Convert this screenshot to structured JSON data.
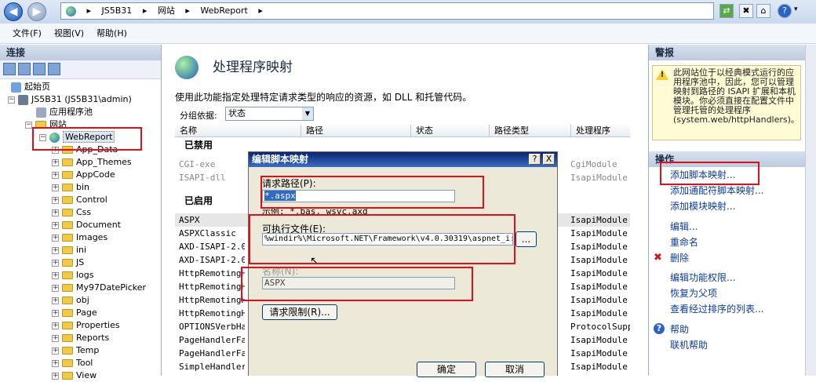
{
  "toolbar": {
    "back_icon": "back-arrow-icon",
    "forward_icon": "forward-arrow-icon",
    "address": [
      "JS5B31",
      "网站",
      "WebReport"
    ],
    "help_label": "?"
  },
  "menu": [
    "文件(F)",
    "视图(V)",
    "帮助(H)"
  ],
  "left": {
    "title": "连接",
    "tree": [
      {
        "label": "起始页",
        "icon": "start-page-icon",
        "level": 1
      },
      {
        "label": "JS5B31 (JS5B31\\admin)",
        "icon": "server-icon",
        "level": 1
      },
      {
        "label": "应用程序池",
        "icon": "app-pool-icon",
        "level": 2
      },
      {
        "label": "网站",
        "icon": "sites-folder-icon",
        "level": 2
      },
      {
        "label": "WebReport",
        "icon": "globe-icon",
        "level": 3
      }
    ],
    "folders": [
      "App_Data",
      "App_Themes",
      "AppCode",
      "bin",
      "Control",
      "Css",
      "Document",
      "Images",
      "ini",
      "JS",
      "logs",
      "My97DatePicker",
      "obj",
      "Page",
      "Properties",
      "Reports",
      "Temp",
      "Tool",
      "View"
    ]
  },
  "center": {
    "title": "处理程序映射",
    "description": "使用此功能指定处理特定请求类型的响应的资源，如 DLL 和托管代码。",
    "group_by_label": "分组依据:",
    "group_by_value": "状态",
    "columns": [
      "名称",
      "路径",
      "状态",
      "路径类型",
      "处理程序"
    ],
    "disabled_header": "已禁用",
    "enabled_header": "已启用",
    "disabled_rows": [
      {
        "name": "CGI-exe",
        "handler": "CgiModule"
      },
      {
        "name": "ISAPI-dll",
        "handler": "IsapiModule"
      }
    ],
    "enabled_rows": [
      {
        "name": "ASPX",
        "handler": "IsapiModule"
      },
      {
        "name": "ASPXClassic",
        "handler": "IsapiModule"
      },
      {
        "name": "AXD-ISAPI-2.0",
        "handler": "IsapiModule"
      },
      {
        "name": "AXD-ISAPI-2.0-6",
        "handler": "IsapiModule"
      },
      {
        "name": "HttpRemotingHan",
        "handler": "IsapiModule"
      },
      {
        "name": "HttpRemotingHan",
        "handler": "IsapiModule"
      },
      {
        "name": "HttpRemotingHan",
        "handler": "IsapiModule"
      },
      {
        "name": "HttpRemotingHan",
        "handler": "IsapiModule"
      },
      {
        "name": "OPTIONSVerbHand",
        "handler": "ProtocolSuppo"
      },
      {
        "name": "PageHandlerFact",
        "handler": "IsapiModule"
      },
      {
        "name": "PageHandlerFact",
        "handler": "IsapiModule"
      },
      {
        "name": "SimpleHandlerFa",
        "handler": "IsapiModule"
      }
    ]
  },
  "right": {
    "alert_title": "警报",
    "alert_text": "此网站位于以经典模式运行的应用程序池中，因此，您可以管理映射到路径的 ISAPI 扩展和本机模块。你必须直接在配置文件中管理托管的处理程序 (system.web/httpHandlers)。",
    "actions_title": "操作",
    "actions": [
      {
        "label": "添加脚本映射...",
        "group": 1
      },
      {
        "label": "添加通配符脚本映射...",
        "group": 1
      },
      {
        "label": "添加模块映射...",
        "group": 1
      },
      {
        "label": "编辑...",
        "group": 2
      },
      {
        "label": "重命名",
        "group": 2
      },
      {
        "label": "删除",
        "group": 2,
        "icon": "delete-x-icon"
      },
      {
        "label": "编辑功能权限...",
        "group": 3
      },
      {
        "label": "恢复为父项",
        "group": 3
      },
      {
        "label": "查看经过排序的列表...",
        "group": 3
      },
      {
        "label": "帮助",
        "group": 4,
        "icon": "help-icon"
      },
      {
        "label": "联机帮助",
        "group": 4
      }
    ]
  },
  "dialog": {
    "title": "编辑脚本映射",
    "help_btn": "?",
    "close_btn": "X",
    "request_path_label": "请求路径(P):",
    "request_path_value": "*.aspx",
    "example": "示例: *.bas, wsvc.axd",
    "executable_label": "可执行文件(E):",
    "executable_value": "%windir%\\Microsoft.NET\\Framework\\v4.0.30319\\aspnet_i:",
    "browse_label": "...",
    "name_label": "名称(N):",
    "name_value": "ASPX",
    "restrictions_label": "请求限制(R)...",
    "ok_label": "确定",
    "cancel_label": "取消"
  },
  "colors": {
    "highlight_box": "#e0101a",
    "link": "#0b3aa8",
    "title_bar": "#0a246a"
  }
}
